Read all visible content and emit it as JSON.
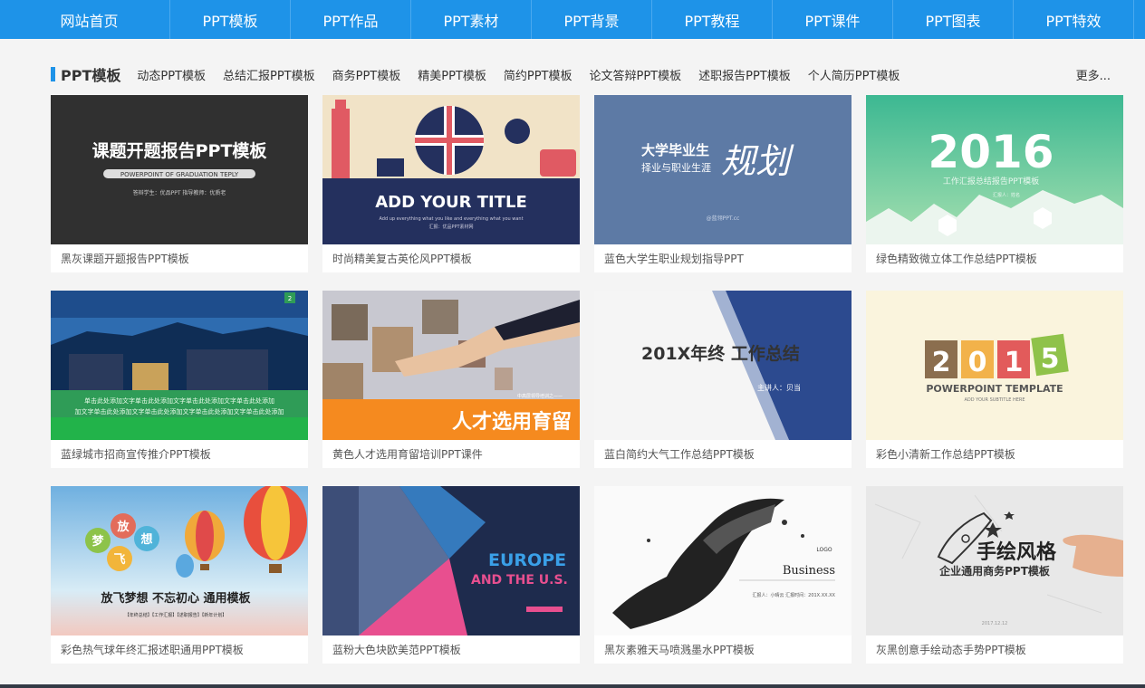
{
  "nav": {
    "items": [
      "网站首页",
      "PPT模板",
      "PPT作品",
      "PPT素材",
      "PPT背景",
      "PPT教程",
      "PPT课件",
      "PPT图表",
      "PPT特效"
    ]
  },
  "section": {
    "title": "PPT模板",
    "categories": [
      "动态PPT模板",
      "总结汇报PPT模板",
      "商务PPT模板",
      "精美PPT模板",
      "简约PPT模板",
      "论文答辩PPT模板",
      "述职报告PPT模板",
      "个人简历PPT模板"
    ],
    "more": "更多..."
  },
  "cards": [
    {
      "caption": "黑灰课题开题报告PPT模板",
      "thumb": {
        "title": "课题开题报告PPT模板",
        "subtitle": "POWERPOINT OF GRADUATION TEPLY",
        "meta": "答辩学生：优品PPT    指导教师：优质老"
      }
    },
    {
      "caption": "时尚精美复古英伦风PPT模板",
      "thumb": {
        "title": "ADD YOUR TITLE",
        "subtitle": "Add up everything what you like and everything what you want",
        "meta": "汇报：优品PPT素材网"
      }
    },
    {
      "caption": "蓝色大学生职业规划指导PPT",
      "thumb": {
        "title_line1": "大学毕业生",
        "title_line2": "择业与职业生涯",
        "script": "规划",
        "meta": "@蓝翎PPT.cc"
      }
    },
    {
      "caption": "绿色精致微立体工作总结PPT模板",
      "thumb": {
        "title": "2016",
        "subtitle": "工作汇报总结报告PPT模板",
        "meta": "汇报人：姓名"
      }
    },
    {
      "caption": "蓝绿城市招商宣传推介PPT模板",
      "thumb": {
        "line1": "单击此处添加文字单击此处添加文字单击此处添加文字单击此处添加",
        "line2": "加文字单击此处添加文字单击此处添加文字单击此处添加文字单击此处添加",
        "page": "2"
      }
    },
    {
      "caption": "黄色人才选用育留培训PPT课件",
      "thumb": {
        "title": "人才选用育留",
        "meta": "中高层领导培训之——"
      }
    },
    {
      "caption": "蓝白简约大气工作总结PPT模板",
      "thumb": {
        "title": "201X年终 工作总结",
        "meta": "主讲人：贝当"
      }
    },
    {
      "caption": "彩色小清新工作总结PPT模板",
      "thumb": {
        "digits": [
          "2",
          "0",
          "1",
          "5"
        ],
        "title": "POWERPOINT TEMPLATE",
        "subtitle": "ADD YOUR SUBTITLE HERE"
      }
    },
    {
      "caption": "彩色热气球年终汇报述职通用PPT模板",
      "thumb": {
        "bubbles": [
          "放",
          "想",
          "梦",
          "飞"
        ],
        "title": "放飞梦想  不忘初心  通用模板",
        "tags": "【年终总结】【工作汇报】【述职报告】【新年计划】"
      }
    },
    {
      "caption": "蓝粉大色块欧美范PPT模板",
      "thumb": {
        "title_line1": "EUROPE",
        "title_line2": "AND THE U.S."
      }
    },
    {
      "caption": "黑灰素雅天马喷溅墨水PPT模板",
      "thumb": {
        "logo": "LOGO",
        "title": "Business",
        "meta": "汇报人：小晴云    汇报时间：201X.XX.XX"
      }
    },
    {
      "caption": "灰黑创意手绘动态手势PPT模板",
      "thumb": {
        "title": "手绘风格",
        "subtitle": "企业通用商务PPT模板",
        "meta": "2017.12.12"
      }
    }
  ],
  "colors": {
    "nav_bg": "#1e93e8",
    "accent": "#1e93e8",
    "page_bg": "#f4f4f4"
  }
}
